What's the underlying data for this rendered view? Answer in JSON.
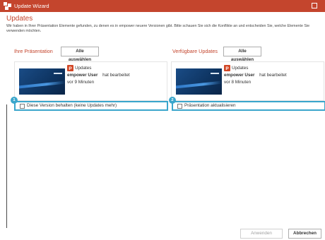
{
  "window": {
    "title": "Update Wizard",
    "accent_color": "#c4452d"
  },
  "header": {
    "title": "Updates",
    "description": "Wir haben in Ihrer Präsentation Elemente gefunden, zu denen es in empower neuere Versionen gibt. Bitte schauen Sie sich die Konflikte an und entscheiden Sie, welche Elemente Sie verwenden möchten."
  },
  "left_panel": {
    "label": "Ihre Präsentation",
    "select_all": "Alle auswählen",
    "card": {
      "doc_title": "Updates",
      "user": "empower User",
      "action": "hat bearbeitet",
      "time": "vor 9 Minuten"
    },
    "option": {
      "badge": "1",
      "label": "Diese Version behalten (keine Updates mehr)",
      "checked": false
    }
  },
  "right_panel": {
    "label": "Verfügbare Updates",
    "select_all": "Alle auswählen",
    "card": {
      "doc_title": "Updates",
      "user": "empower User",
      "action": "hat bearbeitet",
      "time": "vor 8 Minuten"
    },
    "option": {
      "badge": "2",
      "label": "Präsentation aktualisieren",
      "checked": false
    }
  },
  "footer": {
    "apply": "Anwenden",
    "cancel": "Abbrechen"
  },
  "icons": {
    "app": "empower-logo-icon",
    "maximize": "maximize-icon",
    "document": "powerpoint-file-icon"
  }
}
